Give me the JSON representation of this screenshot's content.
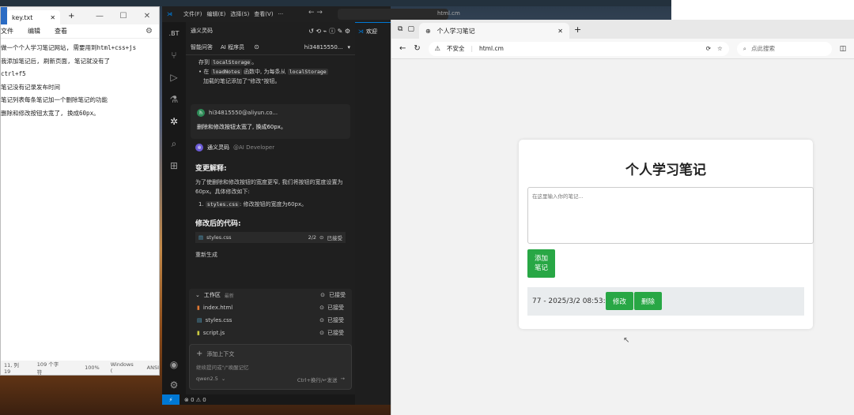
{
  "notepad": {
    "tab_title": "key.txt",
    "menu": [
      "文件",
      "编辑",
      "查看"
    ],
    "lines": [
      "做一个个人学习笔记网站, 需要用到html+css+js",
      "我添加笔记后, 刷新页面, 笔记就没有了",
      "ctrl+f5",
      "笔记没有记录发布时间",
      "笔记列表每条笔记加一个删除笔记的功能",
      "删除和修改按钮太宽了, 换成60px。"
    ],
    "status": [
      "11, 列 19",
      "109 个字符",
      "100%",
      "Windows (",
      "ANSI"
    ]
  },
  "vscode": {
    "menu": [
      "文件(F)",
      "编辑(E)",
      "选择(S)",
      "查看(V)"
    ],
    "panel_title": "通义灵码",
    "tab_label": "欢迎",
    "tabs": [
      "智能问答",
      "AI 程序员"
    ],
    "user_short": "hi34815550...",
    "msg_top": {
      "line1_pre": "存到",
      "line1_code": "localStorage",
      "line1_post": "。",
      "bullet_pre": "在",
      "bullet_code1": "loadNotes",
      "bullet_mid": "函数中, 为每条从",
      "bullet_code2": "localStorage",
      "bullet_post": "加载的笔记添加了\"修改\"按钮。"
    },
    "user_msg": {
      "name": "hi34815550@aliyun.co...",
      "avatar": "h",
      "text": "删除和修改按钮太宽了, 换成60px。"
    },
    "ai_msg": {
      "name": "通义灵码",
      "handle": "@AI Developer",
      "heading1": "变更解释:",
      "para": "为了使删除和修改按钮的宽度更窄, 我们将按钮的宽度设置为60px。具体修改如下:",
      "item_code": "styles.css",
      "item_text": ": 修改按钮的宽度为60px。",
      "heading2": "修改后的代码:",
      "file_name": "styles.css",
      "file_count": "2/2",
      "file_status": "已接受",
      "regen": "重新生成"
    },
    "workspace": {
      "title": "工作区",
      "latest": "最新",
      "status": "已接受",
      "files": [
        {
          "name": "index.html",
          "status": "已接受",
          "color": "#e37933"
        },
        {
          "name": "styles.css",
          "status": "已接受",
          "color": "#519aba"
        },
        {
          "name": "script.js",
          "status": "已接受",
          "color": "#cbcb41"
        }
      ]
    },
    "input": {
      "add_context": "添加上下文",
      "hint": "继续提问或\"/\"唤醒记忆",
      "model": "qwen2.5",
      "send_hint": "Ctrl+换行/↵发送"
    },
    "status_bar": "⊗ 0 ⚠ 0"
  },
  "browser": {
    "tab_title": "个人学习笔记",
    "new_tab": "+",
    "address_bar_text": "html.cm",
    "security": "不安全",
    "url": "html.cm",
    "search_placeholder": "点此搜索",
    "page": {
      "title": "个人学习笔记",
      "textarea_placeholder": "在这里输入你的笔记...",
      "add_button": "添加笔记",
      "note_text": "77 - 2025/3/2 08:53:18",
      "edit_button": "修改",
      "delete_button": "删除"
    }
  },
  "colors": {
    "accent_green": "#28a745",
    "vscode_bg": "#1e1e1e",
    "vscode_accent": "#0078d4"
  }
}
